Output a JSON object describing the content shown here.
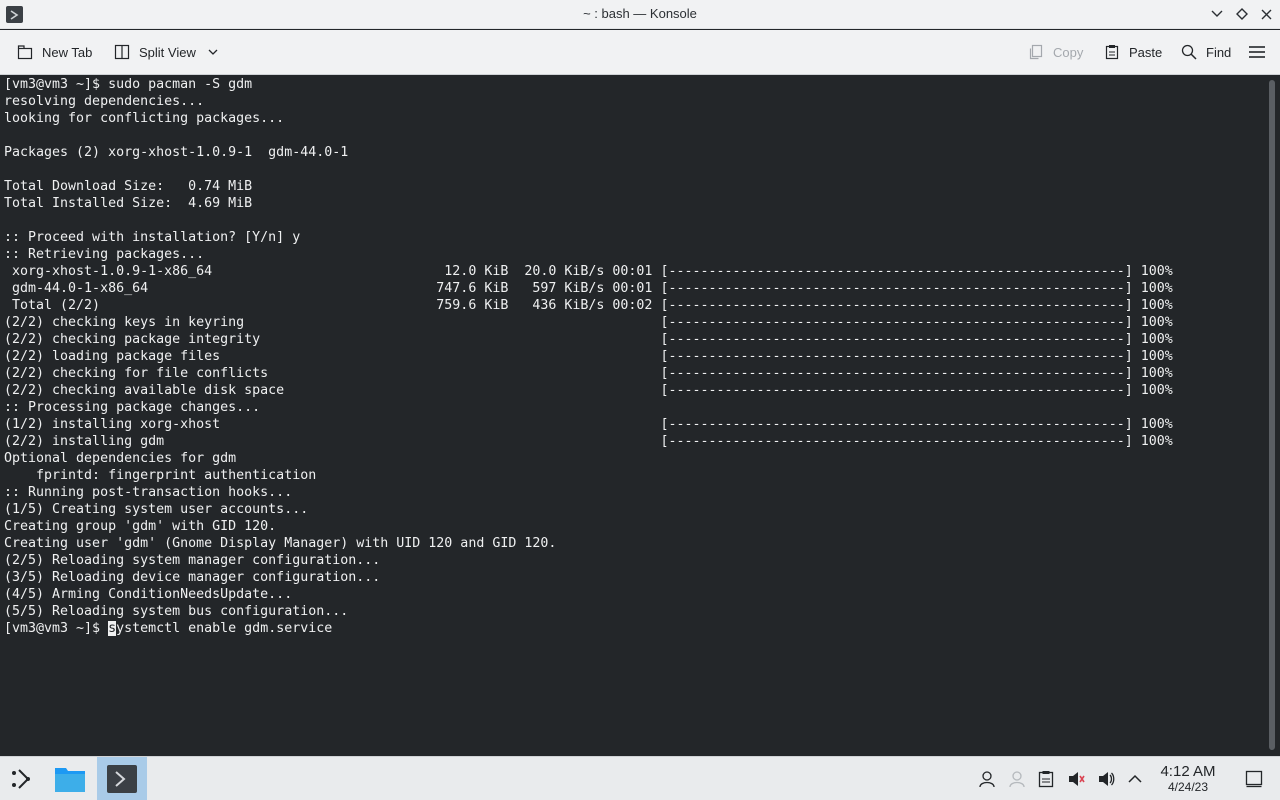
{
  "window": {
    "title": "~ : bash — Konsole"
  },
  "toolbar": {
    "new_tab": "New Tab",
    "split_view": "Split View",
    "copy": "Copy",
    "paste": "Paste",
    "find": "Find"
  },
  "terminal": {
    "lines": [
      "[vm3@vm3 ~]$ sudo pacman -S gdm",
      "resolving dependencies...",
      "looking for conflicting packages...",
      "",
      "Packages (2) xorg-xhost-1.0.9-1  gdm-44.0-1",
      "",
      "Total Download Size:   0.74 MiB",
      "Total Installed Size:  4.69 MiB",
      "",
      ":: Proceed with installation? [Y/n] y",
      ":: Retrieving packages...",
      " xorg-xhost-1.0.9-1-x86_64                             12.0 KiB  20.0 KiB/s 00:01 [---------------------------------------------------------] 100%",
      " gdm-44.0-1-x86_64                                    747.6 KiB   597 KiB/s 00:01 [---------------------------------------------------------] 100%",
      " Total (2/2)                                          759.6 KiB   436 KiB/s 00:02 [---------------------------------------------------------] 100%",
      "(2/2) checking keys in keyring                                                    [---------------------------------------------------------] 100%",
      "(2/2) checking package integrity                                                  [---------------------------------------------------------] 100%",
      "(2/2) loading package files                                                       [---------------------------------------------------------] 100%",
      "(2/2) checking for file conflicts                                                 [---------------------------------------------------------] 100%",
      "(2/2) checking available disk space                                               [---------------------------------------------------------] 100%",
      ":: Processing package changes...",
      "(1/2) installing xorg-xhost                                                       [---------------------------------------------------------] 100%",
      "(2/2) installing gdm                                                              [---------------------------------------------------------] 100%",
      "Optional dependencies for gdm",
      "    fprintd: fingerprint authentication",
      ":: Running post-transaction hooks...",
      "(1/5) Creating system user accounts...",
      "Creating group 'gdm' with GID 120.",
      "Creating user 'gdm' (Gnome Display Manager) with UID 120 and GID 120.",
      "(2/5) Reloading system manager configuration...",
      "(3/5) Reloading device manager configuration...",
      "(4/5) Arming ConditionNeedsUpdate...",
      "(5/5) Reloading system bus configuration..."
    ],
    "prompt": "[vm3@vm3 ~]$ ",
    "cursor_char": "s",
    "input_rest": "ystemctl enable gdm.service"
  },
  "taskbar": {
    "time": "4:12 AM",
    "date": "4/24/23",
    "icons": [
      "app-launcher-icon",
      "file-manager-icon",
      "konsole-icon",
      "user-icon",
      "network-icon",
      "clipboard-icon",
      "notifications-muted-icon",
      "volume-icon",
      "tray-expand-icon",
      "show-desktop-icon"
    ]
  },
  "colors": {
    "terminal_bg": "#232629",
    "terminal_fg": "#eff0f1",
    "chrome_bg": "#f1f2f3",
    "active_task": "#a9cbe8"
  }
}
